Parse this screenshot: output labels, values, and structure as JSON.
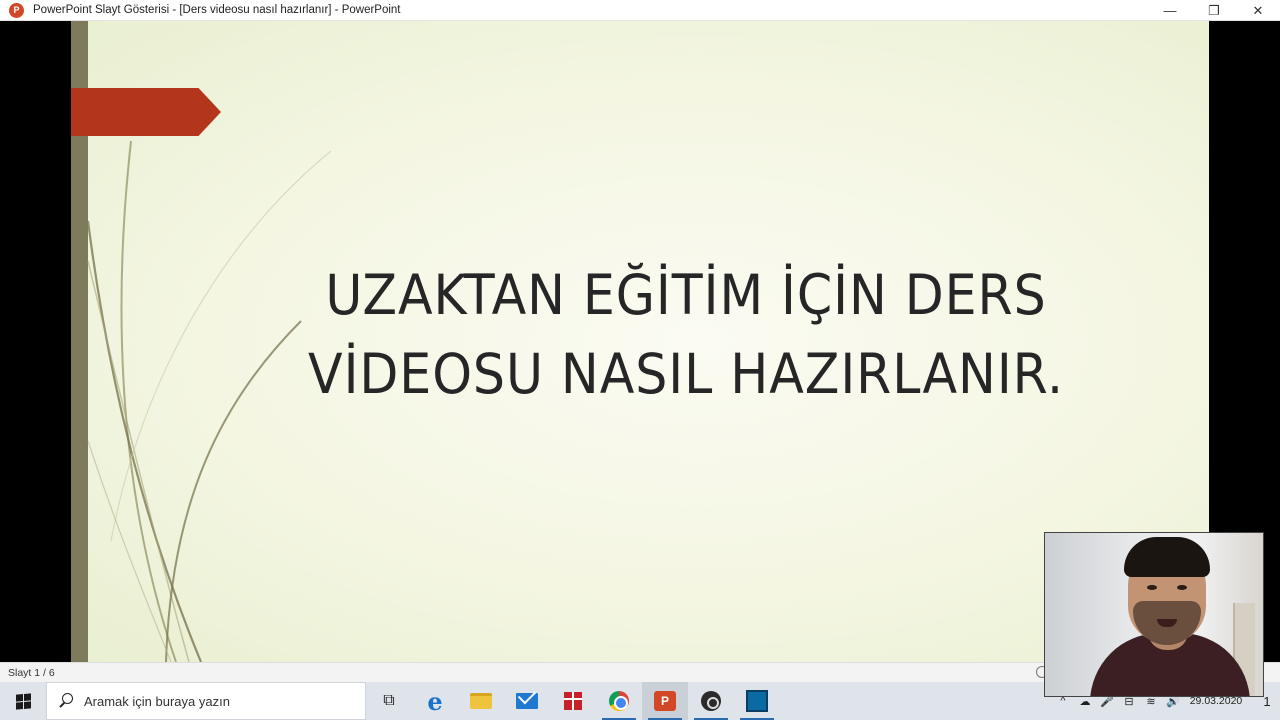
{
  "window": {
    "app_icon_letter": "P",
    "title": "PowerPoint Slayt Gösterisi - [Ders videosu nasıl hazırlanır] - PowerPoint",
    "controls": {
      "minimize": "—",
      "restore": "❐",
      "close": "✕"
    }
  },
  "slide": {
    "title_line1": "UZAKTAN EĞİTİM İÇİN DERS",
    "title_line2": "VİDEOSU NASIL HAZIRLANIR.",
    "accent_color": "#b3351b",
    "sidebar_color": "#7d7b5c"
  },
  "statusbar": {
    "slide_indicator": "Slayt 1 / 6"
  },
  "taskbar": {
    "search_placeholder": "Aramak için buraya yazın",
    "apps": [
      {
        "name": "Görev görünümü",
        "icon": "task-view-icon",
        "glyph": "⧉"
      },
      {
        "name": "Microsoft Edge",
        "icon": "edge-icon",
        "glyph": "e"
      },
      {
        "name": "Dosya Gezgini",
        "icon": "folder-icon",
        "glyph": ""
      },
      {
        "name": "Posta",
        "icon": "mail-icon",
        "glyph": ""
      },
      {
        "name": "Hediye",
        "icon": "gift-icon",
        "glyph": ""
      },
      {
        "name": "Google Chrome",
        "icon": "chrome-icon",
        "glyph": ""
      },
      {
        "name": "PowerPoint",
        "icon": "powerpoint-icon",
        "glyph": "P"
      },
      {
        "name": "OBS Studio",
        "icon": "obs-icon",
        "glyph": ""
      },
      {
        "name": "Uygulama",
        "icon": "app-icon",
        "glyph": ""
      }
    ],
    "tray": {
      "chevron": "^",
      "onedrive": "☁",
      "mic": "🎤",
      "network": "⊟",
      "wifi": "≋",
      "volume": "🔊",
      "date": "29.03.2020",
      "notification_count": "1"
    }
  }
}
